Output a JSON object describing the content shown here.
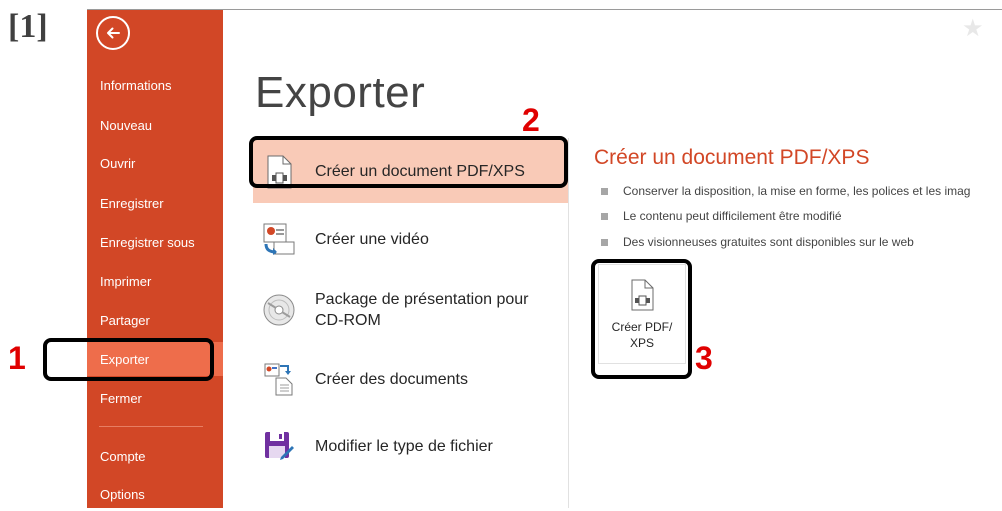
{
  "ref_label": "[1]",
  "colors": {
    "backstage_bg": "#d24726",
    "selected_nav": "#ee6d4b",
    "selected_option": "#f9cab7",
    "detail_title": "#d24726",
    "callout_number": "#e00000"
  },
  "sidebar": {
    "back_icon": "arrow-left-circle-icon",
    "items": [
      {
        "label": "Informations"
      },
      {
        "label": "Nouveau"
      },
      {
        "label": "Ouvrir"
      },
      {
        "label": "Enregistrer"
      },
      {
        "label": "Enregistrer sous"
      },
      {
        "label": "Imprimer"
      },
      {
        "label": "Partager"
      },
      {
        "label": "Exporter",
        "selected": true
      },
      {
        "label": "Fermer"
      },
      {
        "label": "Compte"
      },
      {
        "label": "Options"
      }
    ]
  },
  "main": {
    "title": "Exporter",
    "options": [
      {
        "label": "Créer un document PDF/XPS",
        "icon": "pdf-document-icon",
        "selected": true
      },
      {
        "label": "Créer une vidéo",
        "icon": "video-icon"
      },
      {
        "label_line1": "Package de présentation pour",
        "label_line2": "CD-ROM",
        "icon": "cd-rom-icon"
      },
      {
        "label": "Créer des documents",
        "icon": "handouts-icon"
      },
      {
        "label": "Modifier le type de fichier",
        "icon": "save-file-type-icon"
      }
    ]
  },
  "detail": {
    "title": "Créer un document PDF/XPS",
    "bullets": [
      "Conserver la disposition, la mise en forme, les polices et les imag",
      "Le contenu peut difficilement être modifié",
      "Des visionneuses gratuites sont disponibles sur le web"
    ],
    "button_line1": "Créer PDF/",
    "button_line2": "XPS"
  },
  "callouts": {
    "n1": "1",
    "n2": "2",
    "n3": "3"
  }
}
